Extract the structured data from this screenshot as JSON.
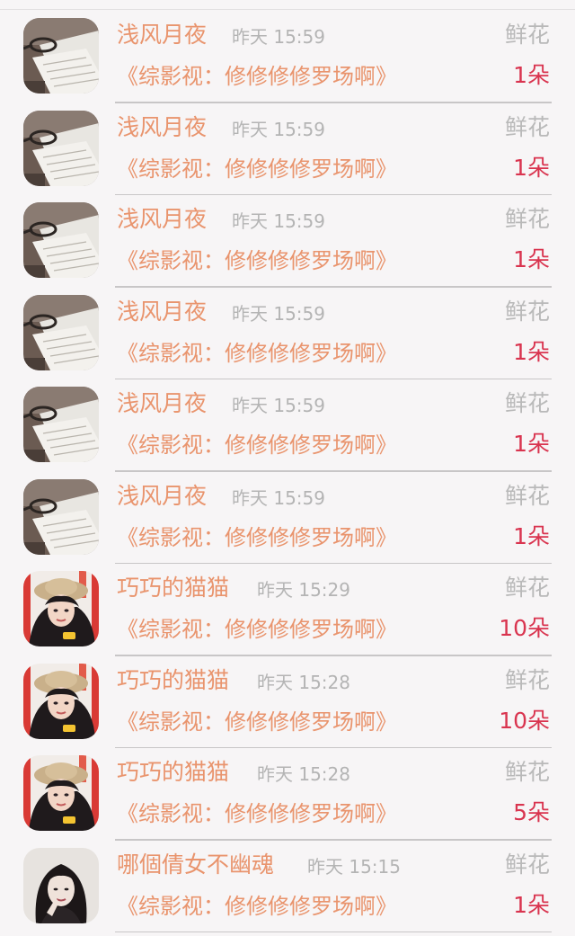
{
  "rows": [
    {
      "name": "浅风月夜",
      "time": "昨天 15:59",
      "gift": "鲜花",
      "book": "《综影视：修修修修罗场啊》",
      "amount": "1朵",
      "avatar": "book-avatar-icon"
    },
    {
      "name": "浅风月夜",
      "time": "昨天 15:59",
      "gift": "鲜花",
      "book": "《综影视：修修修修罗场啊》",
      "amount": "1朵",
      "avatar": "book-avatar-icon"
    },
    {
      "name": "浅风月夜",
      "time": "昨天 15:59",
      "gift": "鲜花",
      "book": "《综影视：修修修修罗场啊》",
      "amount": "1朵",
      "avatar": "book-avatar-icon"
    },
    {
      "name": "浅风月夜",
      "time": "昨天 15:59",
      "gift": "鲜花",
      "book": "《综影视：修修修修罗场啊》",
      "amount": "1朵",
      "avatar": "book-avatar-icon"
    },
    {
      "name": "浅风月夜",
      "time": "昨天 15:59",
      "gift": "鲜花",
      "book": "《综影视：修修修修罗场啊》",
      "amount": "1朵",
      "avatar": "book-avatar-icon"
    },
    {
      "name": "浅风月夜",
      "time": "昨天 15:59",
      "gift": "鲜花",
      "book": "《综影视：修修修修罗场啊》",
      "amount": "1朵",
      "avatar": "book-avatar-icon"
    },
    {
      "name": "巧巧的猫猫",
      "time": "昨天 15:29",
      "gift": "鲜花",
      "book": "《综影视：修修修修罗场啊》",
      "amount": "10朵",
      "avatar": "hat-girl-avatar-icon"
    },
    {
      "name": "巧巧的猫猫",
      "time": "昨天 15:28",
      "gift": "鲜花",
      "book": "《综影视：修修修修罗场啊》",
      "amount": "10朵",
      "avatar": "hat-girl-avatar-icon"
    },
    {
      "name": "巧巧的猫猫",
      "time": "昨天 15:28",
      "gift": "鲜花",
      "book": "《综影视：修修修修罗场啊》",
      "amount": "5朵",
      "avatar": "hat-girl-avatar-icon"
    },
    {
      "name": "哪個倩女不幽魂",
      "time": "昨天 15:15",
      "gift": "鲜花",
      "book": "《综影视：修修修修罗场啊》",
      "amount": "1朵",
      "avatar": "dark-hair-girl-avatar-icon"
    }
  ],
  "colors": {
    "name": "#e9946d",
    "time": "#b4b4b4",
    "gift": "#b9b9b9",
    "amount": "#d9344f",
    "background": "#f7f5f6"
  }
}
